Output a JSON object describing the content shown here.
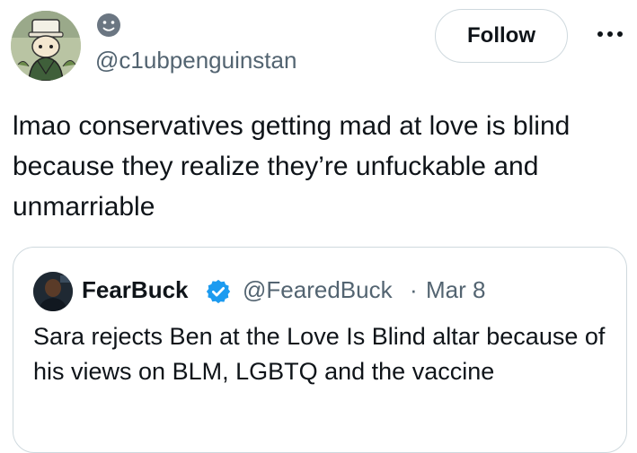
{
  "author": {
    "handle": "@c1ubpenguinstan",
    "avatar_icon": "cartoon-character-avatar",
    "display_name_icon": "slightly-smiling-face-emoji"
  },
  "actions": {
    "follow_label": "Follow",
    "more_icon": "more-dots-icon"
  },
  "tweet": {
    "text": "lmao conservatives getting mad at love is blind because they realize they’re unfuckable and unmarriable"
  },
  "quote": {
    "display_name": "FearBuck",
    "verified_icon": "verified-badge-icon",
    "handle": "@FearedBuck",
    "separator": "·",
    "date": "Mar 8",
    "text": "Sara rejects Ben at the Love Is Blind altar because of his views on BLM, LGBTQ and the vaccine"
  },
  "colors": {
    "text_primary": "#0f1419",
    "text_secondary": "#536471",
    "border": "#cfd9de",
    "verified_blue": "#1d9bf0"
  }
}
